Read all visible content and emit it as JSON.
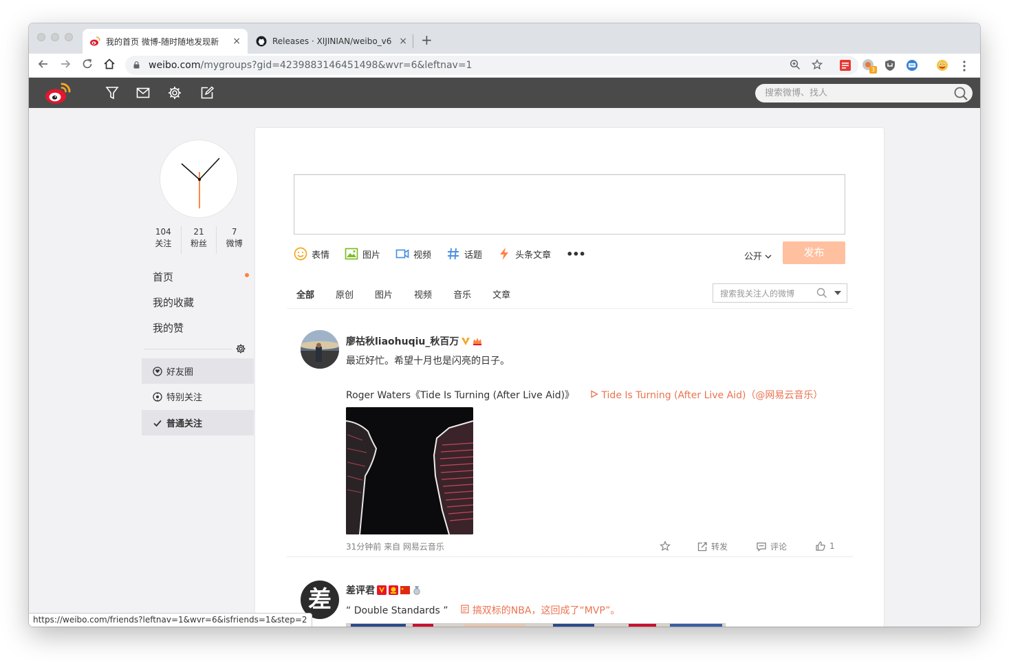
{
  "browser": {
    "tabs": [
      {
        "title": "我的首页 微博-随时随地发现新",
        "close": "×"
      },
      {
        "title": "Releases · XIJINIAN/weibo_v6",
        "close": "×"
      }
    ],
    "new_tab": "+",
    "url_host": "weibo.com",
    "url_path": "/mygroups?gid=4239883146451498&wvr=6&leftnav=1",
    "extension_badge": "3"
  },
  "topbar": {
    "search_placeholder": "搜索微博、找人"
  },
  "profile": {
    "counts": [
      {
        "value": "104",
        "label": "关注"
      },
      {
        "value": "21",
        "label": "粉丝"
      },
      {
        "value": "7",
        "label": "微博"
      }
    ]
  },
  "left_nav": {
    "items": [
      "首页",
      "我的收藏",
      "我的赞"
    ],
    "groups": [
      "好友圈",
      "特别关注",
      "普通关注"
    ]
  },
  "composer": {
    "tools": [
      "表情",
      "图片",
      "视频",
      "话题",
      "头条文章"
    ],
    "more": "•••",
    "visibility": "公开",
    "post_button": "发布"
  },
  "feed_tabs": [
    "全部",
    "原创",
    "图片",
    "视频",
    "音乐",
    "文章"
  ],
  "feed_search_placeholder": "搜索我关注人的微博",
  "posts": [
    {
      "author": "廖祜秋liaohuqiu_秋百万",
      "text": "最近好忙。希望十月也是闪亮的日子。",
      "music_line": "Roger Waters《Tide Is Turning (After Live Aid)》",
      "music_link": "Tide Is Turning (After Live Aid)",
      "music_source_open": "（",
      "music_source": "@网易云音乐",
      "music_source_close": "）",
      "meta": "31分钟前 来自 网易云音乐",
      "repost": "转发",
      "comment": "评论",
      "likes": "1"
    },
    {
      "author": "差评君",
      "avatar_char": "差",
      "quote": "“ Double Standards ”",
      "article_link": "搞双标的NBA，这回成了“MVP”。"
    }
  ],
  "status_url": "https://weibo.com/friends?leftnav=1&wvr=6&isfriends=1&step=2",
  "colors": {
    "accent": "#eb7350",
    "post_button": "#ffc09f",
    "topbar": "#4a4a4a",
    "page_bg": "#f2f2f5"
  }
}
